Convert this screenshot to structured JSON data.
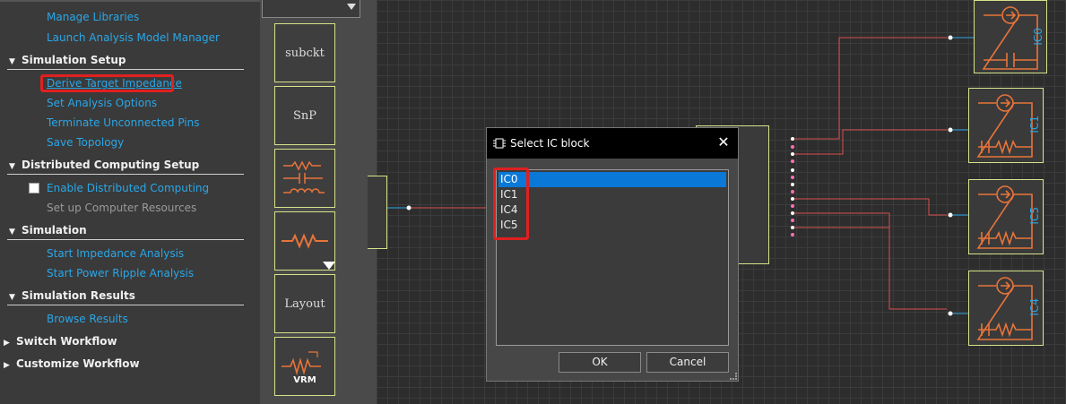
{
  "workflow": {
    "items_top": [
      {
        "label": "Manage Libraries"
      },
      {
        "label": "Launch Analysis Model Manager"
      }
    ],
    "sim_setup": {
      "title": "Simulation Setup",
      "items": [
        "Derive Target Impedance",
        "Set Analysis Options",
        "Terminate Unconnected Pins",
        "Save Topology"
      ]
    },
    "distributed": {
      "title": "Distributed Computing Setup",
      "enable": "Enable Distributed Computing",
      "setup": "Set up Computer Resources"
    },
    "simulation": {
      "title": "Simulation",
      "items": [
        "Start Impedance Analysis",
        "Start Power Ripple Analysis"
      ]
    },
    "results": {
      "title": "Simulation Results",
      "items": [
        "Browse Results"
      ]
    },
    "switch": "Switch Workflow",
    "customize": "Customize Workflow"
  },
  "palette": {
    "subckt": "subckt",
    "snp": "SnP",
    "layout": "Layout",
    "vrm": "VRM"
  },
  "canvas": {
    "ic_labels": [
      "IC0",
      "IC1",
      "IC5",
      "IC4"
    ]
  },
  "dialog": {
    "title": "Select IC block",
    "options": [
      "IC0",
      "IC1",
      "IC4",
      "IC5"
    ],
    "selected": "IC0",
    "ok": "OK",
    "cancel": "Cancel"
  },
  "colors": {
    "link": "#2aa7e8",
    "selection": "#0a78d7",
    "highlight": "#e02020",
    "wire": "#d65050",
    "component": "#e8743a"
  }
}
